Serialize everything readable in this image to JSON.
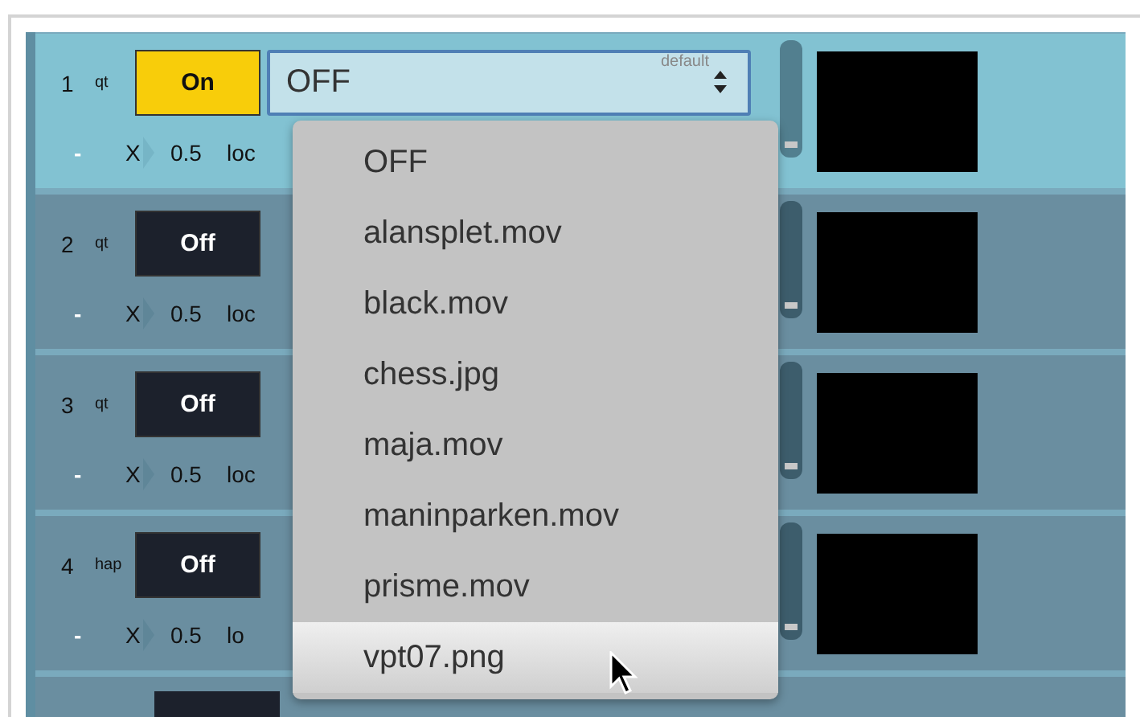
{
  "channels": [
    {
      "number": "1",
      "type": "qt",
      "toggle": {
        "label": "On",
        "on": true
      },
      "selected": true,
      "minus": "-",
      "axis": "X",
      "value": "0.5",
      "loc": "loc"
    },
    {
      "number": "2",
      "type": "qt",
      "toggle": {
        "label": "Off",
        "on": false
      },
      "selected": false,
      "minus": "-",
      "axis": "X",
      "value": "0.5",
      "loc": "loc"
    },
    {
      "number": "3",
      "type": "qt",
      "toggle": {
        "label": "Off",
        "on": false
      },
      "selected": false,
      "minus": "-",
      "axis": "X",
      "value": "0.5",
      "loc": "loc"
    },
    {
      "number": "4",
      "type": "hap",
      "toggle": {
        "label": "Off",
        "on": false
      },
      "selected": false,
      "minus": "-",
      "axis": "X",
      "value": "0.5",
      "loc": "lo"
    }
  ],
  "dropdown": {
    "value": "OFF",
    "hint": "default",
    "options": [
      {
        "label": "OFF",
        "highlighted": false
      },
      {
        "label": "alansplet.mov",
        "highlighted": false
      },
      {
        "label": "black.mov",
        "highlighted": false
      },
      {
        "label": "chess.jpg",
        "highlighted": false
      },
      {
        "label": "maja.mov",
        "highlighted": false
      },
      {
        "label": "maninparken.mov",
        "highlighted": false
      },
      {
        "label": "prisme.mov",
        "highlighted": false
      },
      {
        "label": "vpt07.png",
        "highlighted": true
      }
    ]
  }
}
